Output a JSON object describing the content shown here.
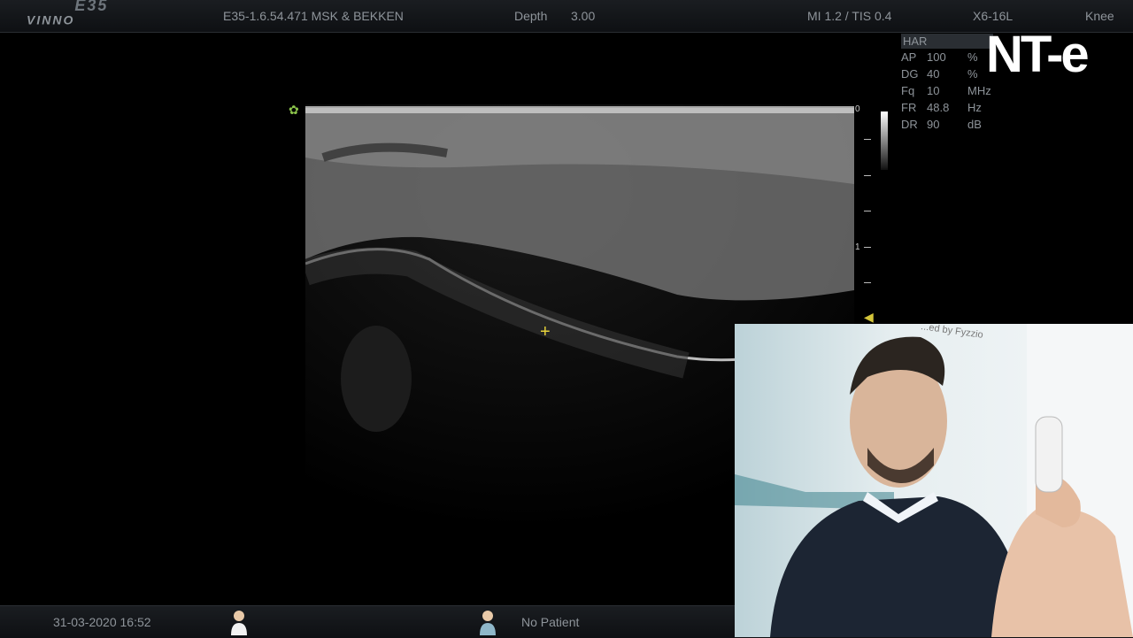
{
  "topbar": {
    "logo": "VINNO",
    "logo_model": "E35",
    "preset": "E35-1.6.54.471 MSK & BEKKEN",
    "depth_label": "Depth",
    "depth_value": "3.00",
    "mi_tis": "MI 1.2  /  TIS  0.4",
    "probe": "X6-16L",
    "exam": "Knee"
  },
  "params": {
    "mode": "HAR",
    "rows": [
      {
        "key": "AP",
        "value": "100",
        "unit": "%"
      },
      {
        "key": "DG",
        "value": "40",
        "unit": "%"
      },
      {
        "key": "Fq",
        "value": "10",
        "unit": "MHz"
      },
      {
        "key": "FR",
        "value": "48.8",
        "unit": "Hz"
      },
      {
        "key": "DR",
        "value": "90",
        "unit": "dB"
      }
    ]
  },
  "watermark": "NT-e",
  "depth_scale": {
    "top": "0",
    "mid": "1"
  },
  "bottombar": {
    "datetime": "31-03-2020 16:52",
    "patient": "No Patient"
  },
  "webcam": {
    "caption": "...ed by Fyzzio"
  }
}
